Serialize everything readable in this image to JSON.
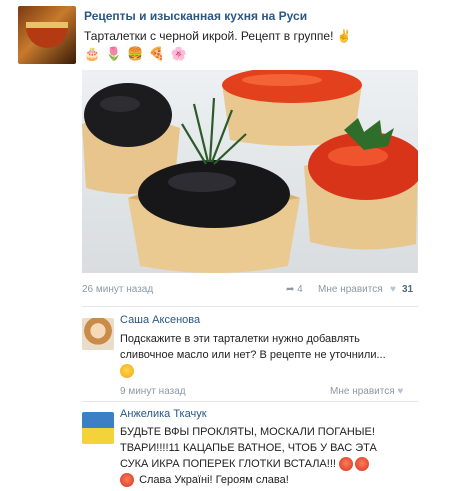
{
  "post": {
    "group_name": "Рецепты и изысканная кухня на Руси",
    "text": "Тарталетки с черной икрой. Рецепт в группе! ✌",
    "emojis": [
      "🎂",
      "🌷",
      "🍔",
      "🍕",
      "🌸"
    ],
    "time": "26 минут назад",
    "shares": "4",
    "likes_label": "Мне нравится",
    "likes_count": "31",
    "icons": [
      "share-icon",
      "heart-icon"
    ]
  },
  "comments": [
    {
      "author": "Саша Аксенова",
      "lines": [
        "Подскажите в эти тарталетки нужно добавлять",
        "сливочное масло или нет? В рецепте не уточнили..."
      ],
      "time": "9 минут назад",
      "like_label": "Мне нравится"
    },
    {
      "author": "Анжелика Ткачук",
      "lines": [
        "БУДЬТЕ ВФЫ ПРОКЛЯТЫ, МОСКАЛИ ПОГАНЫЕ!",
        "ТВАРИ!!!!11 КАЦАПЬЕ ВАТНОЕ, ЧТОБ У ВАС ЭТА",
        "СУКА ИКРА ПОПЕРЕК ГЛОТКИ ВСТАЛА!!!",
        "Слава Україні! Героям слава!"
      ]
    }
  ]
}
